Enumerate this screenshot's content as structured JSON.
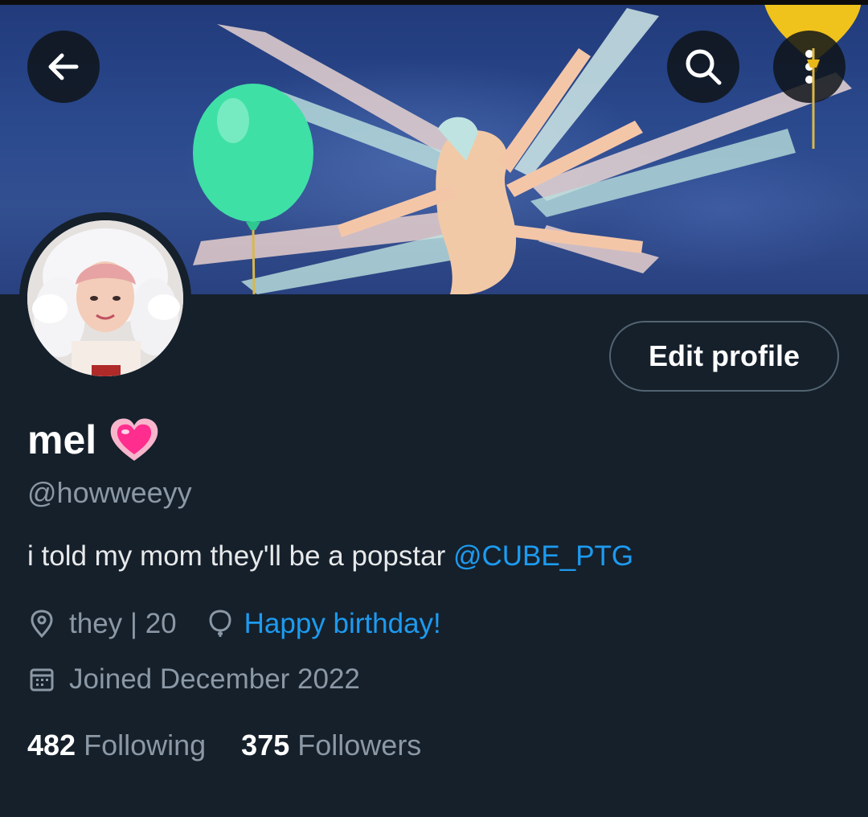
{
  "header": {
    "back_icon": "arrow-left-icon",
    "search_icon": "search-icon",
    "more_icon": "more-vertical-icon"
  },
  "banner": {
    "decorations": [
      "green-balloon",
      "yellow-balloon"
    ]
  },
  "profile": {
    "name": "mel",
    "name_emoji": "heart-emoji",
    "handle": "@howweeyy",
    "bio_text": "i told my mom they'll be a popstar ",
    "bio_mention": "@CUBE_PTG",
    "location": "they | 20",
    "birthday": "Happy birthday!",
    "joined": "Joined December 2022",
    "edit_label": "Edit profile"
  },
  "stats": {
    "following_count": "482",
    "following_label": "Following",
    "followers_count": "375",
    "followers_label": "Followers"
  },
  "colors": {
    "background": "#15202b",
    "accent": "#1d9bf0",
    "muted": "#8b98a5"
  }
}
